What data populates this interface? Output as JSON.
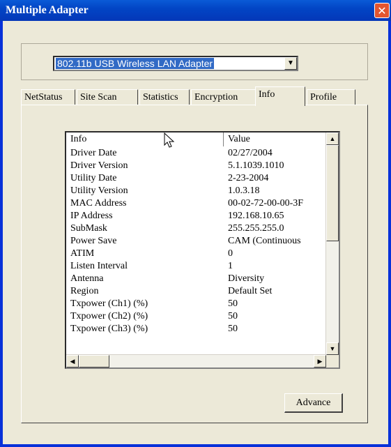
{
  "window": {
    "title": "Multiple Adapter",
    "close_glyph": "✕"
  },
  "adapter_select": {
    "value": "802.11b USB Wireless LAN Adapter",
    "arrow_glyph": "▼"
  },
  "tabs": [
    {
      "label": "NetStatus",
      "active": false
    },
    {
      "label": "Site Scan",
      "active": false
    },
    {
      "label": "Statistics",
      "active": false
    },
    {
      "label": "Encryption",
      "active": false
    },
    {
      "label": "Info",
      "active": true
    },
    {
      "label": "Profile",
      "active": false
    }
  ],
  "info_list": {
    "columns": [
      "Info",
      "Value"
    ],
    "rows": [
      [
        "Driver Date",
        "02/27/2004"
      ],
      [
        "Driver Version",
        "5.1.1039.1010"
      ],
      [
        "Utility Date",
        "2-23-2004"
      ],
      [
        "Utility Version",
        "1.0.3.18"
      ],
      [
        "MAC Address",
        "00-02-72-00-00-3F"
      ],
      [
        "IP Address",
        "192.168.10.65"
      ],
      [
        "SubMask",
        "255.255.255.0"
      ],
      [
        "Power Save",
        "CAM (Continuous"
      ],
      [
        "ATIM",
        "0"
      ],
      [
        "Listen Interval",
        "1"
      ],
      [
        "Antenna",
        "Diversity"
      ],
      [
        "Region",
        "Default Set"
      ],
      [
        "Txpower (Ch1) (%)",
        "50"
      ],
      [
        "Txpower (Ch2) (%)",
        "50"
      ],
      [
        "Txpower (Ch3) (%)",
        "50"
      ]
    ],
    "scroll_up_glyph": "▲",
    "scroll_down_glyph": "▼",
    "scroll_left_glyph": "◀",
    "scroll_right_glyph": "▶"
  },
  "buttons": {
    "advance": "Advance"
  },
  "colors": {
    "titlebar": "#0a5bd7",
    "selection": "#316ac5",
    "close": "#e2552f",
    "face": "#ece9d8"
  }
}
